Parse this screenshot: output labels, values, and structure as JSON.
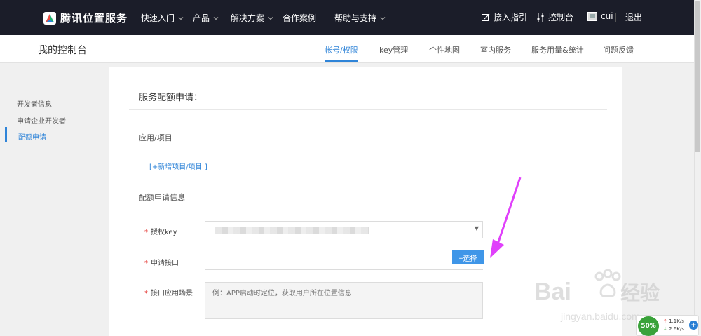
{
  "topnav": {
    "brand": "腾讯位置服务",
    "items": [
      {
        "label": "快速入门"
      },
      {
        "label": "产品"
      },
      {
        "label": "解决方案"
      },
      {
        "label": "合作案例"
      },
      {
        "label": "帮助与支持"
      }
    ],
    "guide": "接入指引",
    "console": "控制台",
    "user": "cui",
    "logout": "退出"
  },
  "subheader": {
    "title": "我的控制台",
    "tabs": [
      {
        "label": "帐号/权限",
        "active": true
      },
      {
        "label": "key管理"
      },
      {
        "label": "个性地图"
      },
      {
        "label": "室内服务"
      },
      {
        "label": "服务用量&统计"
      },
      {
        "label": "问题反馈"
      }
    ]
  },
  "sidebar": {
    "items": [
      {
        "label": "开发者信息"
      },
      {
        "label": "申请企业开发者"
      },
      {
        "label": "配额申请",
        "active": true
      }
    ]
  },
  "form": {
    "title": "服务配额申请：",
    "app_section": "应用/项目",
    "add_project": "[+新增项目/项目 ]",
    "info_section": "配额申请信息",
    "key_label": "授权key",
    "api_label": "申请接口",
    "choose_button": "+选择",
    "scene_label": "接口应用场景",
    "scene_placeholder": "例：APP启动时定位，获取用户所在位置信息",
    "required_mark": "*"
  },
  "network": {
    "percent": "50%",
    "up": "1.1K/s",
    "down": "2.6K/s"
  },
  "colors": {
    "accent": "#2f84d8",
    "nav_bg": "#1b1d29",
    "button": "#3f96e8",
    "required": "#e53935",
    "annotation_arrow": "#e040fb"
  }
}
